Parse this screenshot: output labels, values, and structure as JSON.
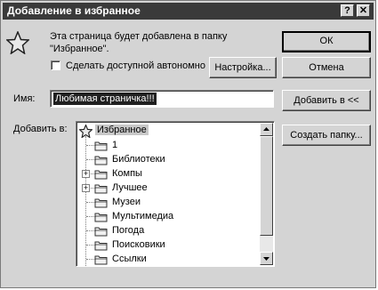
{
  "dialog": {
    "title": "Добавление в избранное",
    "help_label": "?",
    "close_label": "✕"
  },
  "info": {
    "message_line1": "Эта страница будет добавлена в папку",
    "message_line2": "\"Избранное\"."
  },
  "offline": {
    "label": "Сделать доступной автономно",
    "checked": false
  },
  "buttons": {
    "ok": "ОК",
    "cancel": "Отмена",
    "customize": "Настройка...",
    "add_to": "Добавить в <<",
    "new_folder": "Создать папку..."
  },
  "name_field": {
    "label": "Имя:",
    "value": "Любимая страничка!!!"
  },
  "tree": {
    "label": "Добавить в:",
    "root": "Избранное",
    "items": [
      {
        "label": "1",
        "expandable": false
      },
      {
        "label": "Библиотеки",
        "expandable": false
      },
      {
        "label": "Компы",
        "expandable": true
      },
      {
        "label": "Лучшее",
        "expandable": true
      },
      {
        "label": "Музеи",
        "expandable": false
      },
      {
        "label": "Мультимедиа",
        "expandable": false
      },
      {
        "label": "Погода",
        "expandable": false
      },
      {
        "label": "Поисковики",
        "expandable": false
      },
      {
        "label": "Ссылки",
        "expandable": false
      }
    ]
  }
}
